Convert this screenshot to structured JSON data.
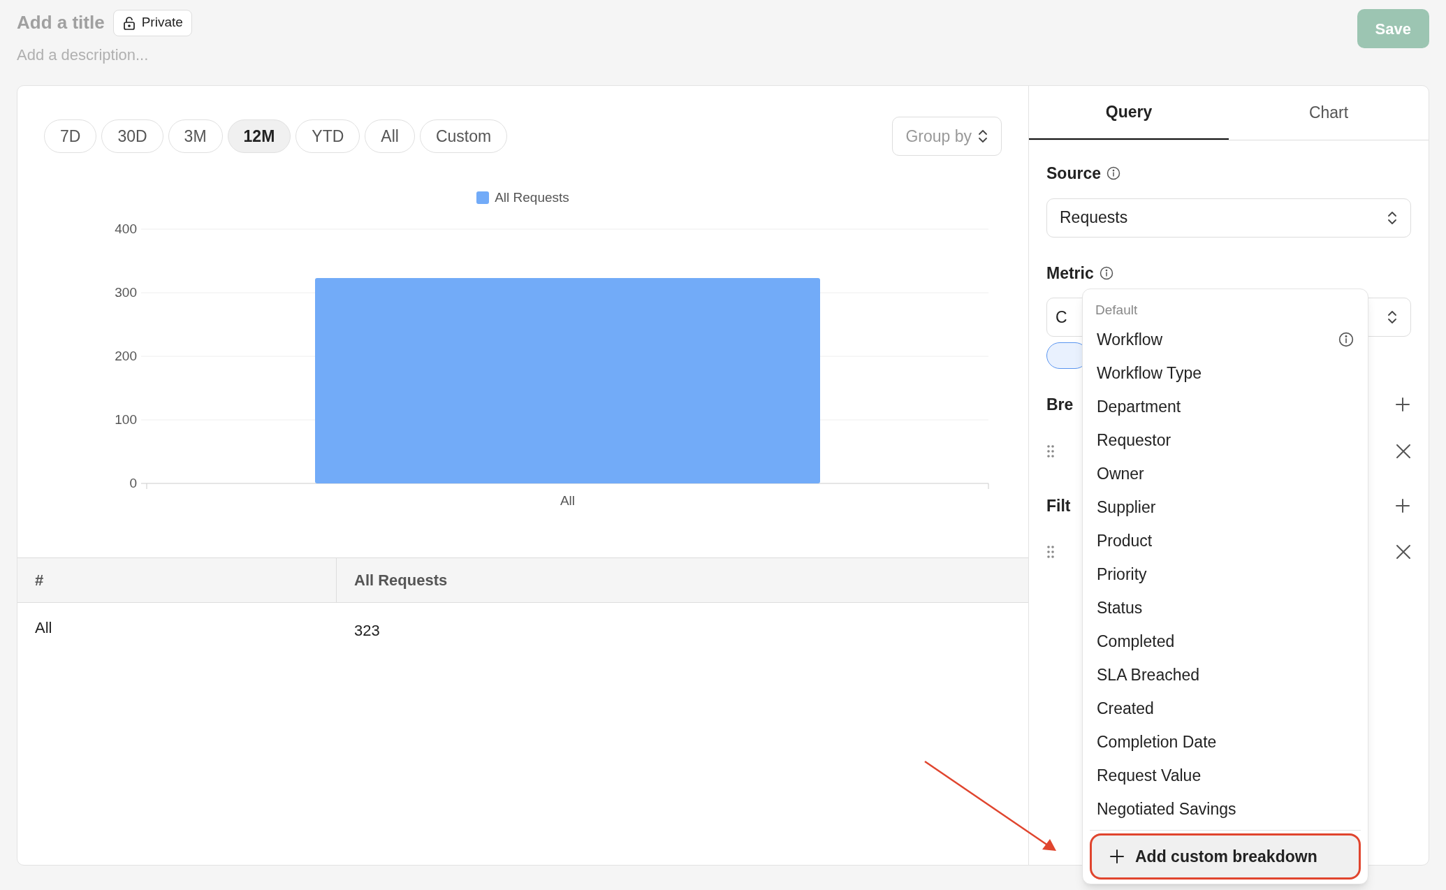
{
  "header": {
    "title_placeholder": "Add a title",
    "privacy": "Private",
    "description_placeholder": "Add a description...",
    "save": {
      "label": "Save",
      "disabled": true
    }
  },
  "time_ranges": [
    {
      "label": "7D",
      "selected": false
    },
    {
      "label": "30D",
      "selected": false
    },
    {
      "label": "3M",
      "selected": false
    },
    {
      "label": "12M",
      "selected": true
    },
    {
      "label": "YTD",
      "selected": false
    },
    {
      "label": "All",
      "selected": false
    },
    {
      "label": "Custom",
      "selected": false
    }
  ],
  "group_by": {
    "placeholder": "Group by"
  },
  "chart": {
    "chart_data": {
      "type": "bar",
      "categories": [
        "All"
      ],
      "series": [
        {
          "name": "All Requests",
          "color": "#72abf8",
          "values": [
            323
          ]
        }
      ],
      "ylim": [
        0,
        400
      ],
      "grid": true,
      "yticks": [
        0,
        100,
        200,
        300,
        400
      ]
    }
  },
  "table": {
    "columns": [
      "#",
      "All Requests"
    ],
    "rows": [
      [
        "All",
        "323"
      ]
    ]
  },
  "tabs": [
    {
      "label": "Query",
      "selected": true
    },
    {
      "label": "Chart",
      "selected": false
    }
  ],
  "source": {
    "label": "Source",
    "value": "Requests"
  },
  "metric": {
    "label": "Metric",
    "value": "C"
  },
  "breakdowns": {
    "label": "Bre"
  },
  "filters": {
    "label": "Filt"
  },
  "dropdown": {
    "section": "Default",
    "items": [
      {
        "label": "Workflow",
        "info": true
      },
      {
        "label": "Workflow Type",
        "info": false
      },
      {
        "label": "Department",
        "info": false
      },
      {
        "label": "Requestor",
        "info": false
      },
      {
        "label": "Owner",
        "info": false
      },
      {
        "label": "Supplier",
        "info": false
      },
      {
        "label": "Product",
        "info": false
      },
      {
        "label": "Priority",
        "info": false
      },
      {
        "label": "Status",
        "info": false
      },
      {
        "label": "Completed",
        "info": false
      },
      {
        "label": "SLA Breached",
        "info": false
      },
      {
        "label": "Created",
        "info": false
      },
      {
        "label": "Completion Date",
        "info": false
      },
      {
        "label": "Request Value",
        "info": false
      },
      {
        "label": "Negotiated Savings",
        "info": false
      }
    ],
    "action": "Add custom breakdown"
  }
}
